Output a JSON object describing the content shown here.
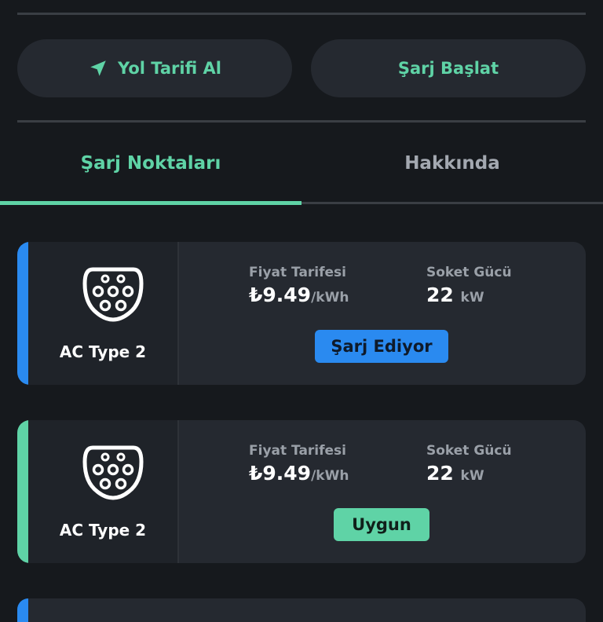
{
  "actions": {
    "directions_label": "Yol Tarifi Al",
    "start_charge_label": "Şarj Başlat"
  },
  "tabs": [
    {
      "label": "Şarj Noktaları",
      "active": true
    },
    {
      "label": "Hakkında",
      "active": false
    }
  ],
  "connectors": [
    {
      "type": "AC Type 2",
      "price_label": "Fiyat Tarifesi",
      "price": "₺9.49",
      "price_unit": "/kWh",
      "power_label": "Soket Gücü",
      "power": "22",
      "power_unit": "kW",
      "status": "Şarj Ediyor",
      "accent_color": "#2a8af0"
    },
    {
      "type": "AC Type 2",
      "price_label": "Fiyat Tarifesi",
      "price": "₺9.49",
      "price_unit": "/kWh",
      "power_label": "Soket Gücü",
      "power": "22",
      "power_unit": "kW",
      "status": "Uygun",
      "accent_color": "#5fd3a6"
    }
  ],
  "colors": {
    "accent": "#5fd3a6",
    "charging": "#2a8af0",
    "background": "#16191d",
    "card": "#252930"
  }
}
